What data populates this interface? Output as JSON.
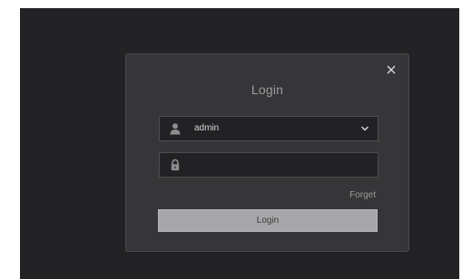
{
  "dialog": {
    "title": "Login",
    "close_icon": "close-icon",
    "username": {
      "icon": "user-icon",
      "value": "admin",
      "dropdown_icon": "chevron-down-icon"
    },
    "password": {
      "icon": "lock-icon",
      "value": "",
      "placeholder": ""
    },
    "forget_label": "Forget",
    "login_label": "Login"
  },
  "colors": {
    "screen_background": "#232325",
    "dialog_background": "#363638",
    "field_background": "#222224",
    "button_background": "#a7a7a9"
  }
}
